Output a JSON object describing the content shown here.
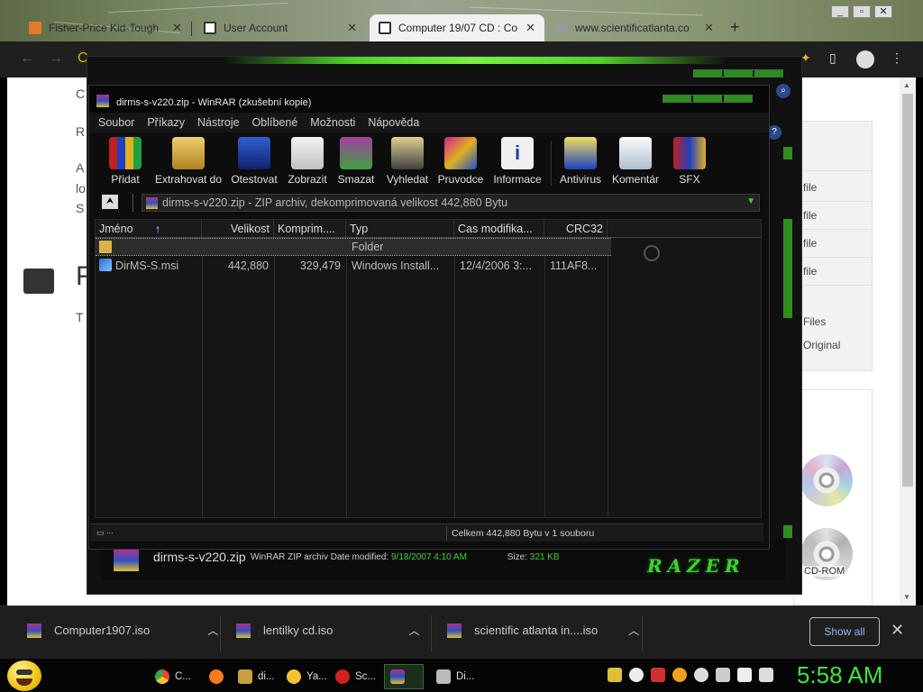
{
  "browser": {
    "tabs": [
      {
        "title": "Fisher-Price Kid-Tough",
        "active": false
      },
      {
        "title": "User Account",
        "active": false
      },
      {
        "title": "Computer 19/07 CD : Co",
        "active": true
      },
      {
        "title": "www.scientificatlanta.co",
        "active": false
      }
    ],
    "new_tab": "+",
    "window_controls": [
      "_",
      "▫",
      "✕"
    ]
  },
  "page_behind": {
    "letters": [
      "C",
      "R",
      "A",
      "lo",
      "S",
      "F",
      "T"
    ],
    "file_counts": [
      "1 file",
      "1 file",
      "1 file",
      "1 file"
    ],
    "files_total": "8 Files",
    "original": "7 Original",
    "cd_label": "CD-ROM"
  },
  "winrar": {
    "title": "dirms-s-v220.zip - WinRAR (zkušební kopie)",
    "menu": [
      "Soubor",
      "Příkazy",
      "Nástroje",
      "Oblíbené",
      "Možnosti",
      "Nápověda"
    ],
    "toolbar": [
      {
        "label": "Přidat",
        "icon": "books-add-icon"
      },
      {
        "label": "Extrahovat do",
        "icon": "folder-extract-icon"
      },
      {
        "label": "Otestovat",
        "icon": "checkmark-test-icon"
      },
      {
        "label": "Zobrazit",
        "icon": "glasses-view-icon"
      },
      {
        "label": "Smazat",
        "icon": "delete-icon"
      },
      {
        "label": "Vyhledat",
        "icon": "binoculars-find-icon"
      },
      {
        "label": "Pruvodce",
        "icon": "wizard-icon"
      },
      {
        "label": "Informace",
        "icon": "info-icon"
      },
      {
        "label": "Antivirus",
        "icon": "antivirus-icon"
      },
      {
        "label": "Komentár",
        "icon": "comment-icon"
      },
      {
        "label": "SFX",
        "icon": "sfx-icon"
      }
    ],
    "address": "dirms-s-v220.zip - ZIP archiv, dekomprimovaná velikost 442,880 Bytu",
    "columns": [
      "Jméno",
      "Velikost",
      "Komprim....",
      "Typ",
      "Cas modifika...",
      "CRC32"
    ],
    "rows": [
      {
        "name": "",
        "size": "",
        "packed": "",
        "type": "Folder",
        "modified": "",
        "crc": "",
        "selected": true
      },
      {
        "name": "DirMS-S.msi",
        "size": "442,880",
        "packed": "329,479",
        "type": "Windows Install...",
        "modified": "12/4/2006 3:...",
        "crc": "111AF8...",
        "selected": false
      }
    ],
    "status": "Celkem 442,880 Bytu v 1 souboru"
  },
  "info_strip": {
    "filename": "dirms-s-v220.zip",
    "type_label": "WinRAR ZIP archiv",
    "date_label": "Date modified:",
    "date_value": "9/18/2007 4:10 AM",
    "size_label": "Size:",
    "size_value": "321 KB",
    "brand": "RAZER"
  },
  "downloads": {
    "items": [
      "Computer1907.iso",
      "lentilky cd.iso",
      "scientific atlanta in....iso"
    ],
    "show_all": "Show all",
    "close": "✕"
  },
  "taskbar": {
    "items": [
      {
        "label": "C...",
        "color": "#e8453c"
      },
      {
        "label": "",
        "color": "#ff7a1a"
      },
      {
        "label": "di...",
        "color": "#c8a040"
      },
      {
        "label": "Ya...",
        "color": "#f4c430"
      },
      {
        "label": "Sc...",
        "color": "#d02020"
      },
      {
        "label": "",
        "color": "#6a3aa0"
      },
      {
        "label": "Di...",
        "color": "#bbbbbb"
      }
    ],
    "clock": "5:58 AM"
  },
  "colors": {
    "accent_green": "#3fd030",
    "chrome_link": "#8ab4f8"
  }
}
